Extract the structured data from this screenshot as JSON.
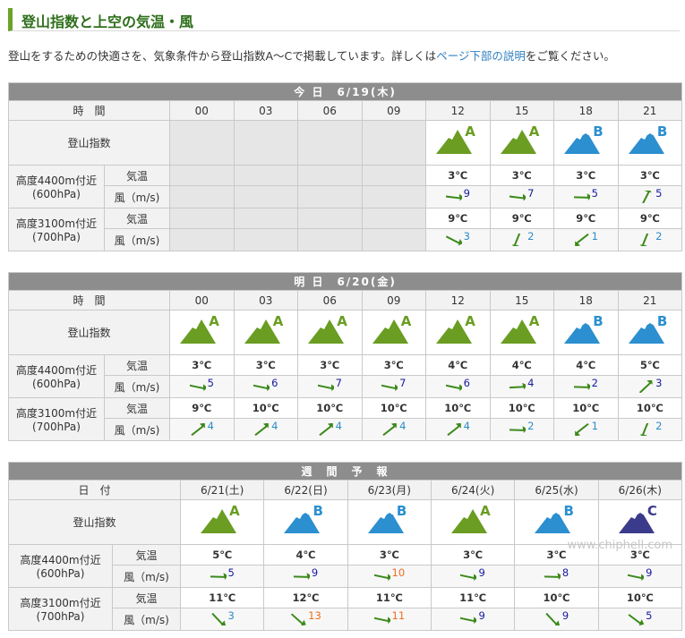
{
  "page_title": "登山指数と上空の気温・風",
  "intro": {
    "before": "登山をするための快適さを、気象条件から登山指数A～Cで掲載しています。詳しくは",
    "link": "ページ下部の説明",
    "after": "をご覧ください。"
  },
  "labels": {
    "time": "時　間",
    "date": "日　付",
    "index": "登山指数",
    "alt_high": "高度4400m付近",
    "alt_high_hpa": "(600hPa)",
    "alt_low": "高度3100m付近",
    "alt_low_hpa": "(700hPa)",
    "temp": "気温",
    "wind": "風（m/s)"
  },
  "colors": {
    "greenMountain": "#6a9d22",
    "blueMountain": "#2b8fd0",
    "navyMountain": "#3b3b8c"
  },
  "today": {
    "header": "今 日　6/19(木)",
    "times": [
      "00",
      "03",
      "06",
      "09",
      "12",
      "15",
      "18",
      "21"
    ],
    "index": [
      "",
      "",
      "",
      "",
      "A",
      "A",
      "B",
      "B"
    ],
    "high_temp": [
      "",
      "",
      "",
      "",
      "3℃",
      "3℃",
      "3℃",
      "3℃"
    ],
    "high_wind": [
      null,
      null,
      null,
      null,
      {
        "v": "9",
        "d": 35
      },
      {
        "v": "7",
        "d": 35
      },
      {
        "v": "5",
        "d": 30
      },
      {
        "v": "5",
        "d": -35
      }
    ],
    "low_temp": [
      "",
      "",
      "",
      "",
      "9℃",
      "9℃",
      "9℃",
      "9℃"
    ],
    "low_wind": [
      null,
      null,
      null,
      null,
      {
        "v": "3",
        "d": 55
      },
      {
        "v": "2",
        "d": 140
      },
      {
        "v": "1",
        "d": 170
      },
      {
        "v": "2",
        "d": 140
      }
    ]
  },
  "tomorrow": {
    "header": "明 日　6/20(金)",
    "times": [
      "00",
      "03",
      "06",
      "09",
      "12",
      "15",
      "18",
      "21"
    ],
    "index": [
      "A",
      "A",
      "A",
      "A",
      "A",
      "A",
      "B",
      "B"
    ],
    "high_temp": [
      "3℃",
      "3℃",
      "3℃",
      "3℃",
      "4℃",
      "4℃",
      "4℃",
      "5℃"
    ],
    "high_wind": [
      {
        "v": "5",
        "d": 40
      },
      {
        "v": "6",
        "d": 40
      },
      {
        "v": "7",
        "d": 40
      },
      {
        "v": "7",
        "d": 40
      },
      {
        "v": "6",
        "d": 40
      },
      {
        "v": "4",
        "d": 25
      },
      {
        "v": "2",
        "d": 30
      },
      {
        "v": "3",
        "d": -15
      }
    ],
    "low_temp": [
      "9℃",
      "10℃",
      "10℃",
      "10℃",
      "10℃",
      "10℃",
      "10℃",
      "10℃"
    ],
    "low_wind": [
      {
        "v": "4",
        "d": -10
      },
      {
        "v": "4",
        "d": -10
      },
      {
        "v": "4",
        "d": -10
      },
      {
        "v": "4",
        "d": -10
      },
      {
        "v": "4",
        "d": -10
      },
      {
        "v": "2",
        "d": 30
      },
      {
        "v": "1",
        "d": 170
      },
      {
        "v": "2",
        "d": 140
      }
    ]
  },
  "weekly": {
    "header": "週　間　予　報",
    "dates": [
      "6/21(土)",
      "6/22(日)",
      "6/23(月)",
      "6/24(火)",
      "6/25(水)",
      "6/26(木)"
    ],
    "index": [
      "A",
      "B",
      "B",
      "A",
      "B",
      "C"
    ],
    "high_temp": [
      "5℃",
      "4℃",
      "3℃",
      "3℃",
      "3℃",
      "3℃"
    ],
    "high_wind": [
      {
        "v": "5",
        "d": 30,
        "c": "blue"
      },
      {
        "v": "9",
        "d": 30,
        "c": "blue"
      },
      {
        "v": "10",
        "d": 40,
        "c": "orange"
      },
      {
        "v": "9",
        "d": 40,
        "c": "blue"
      },
      {
        "v": "8",
        "d": 30,
        "c": "blue"
      },
      {
        "v": "9",
        "d": 40,
        "c": "blue"
      }
    ],
    "low_temp": [
      "11℃",
      "12℃",
      "11℃",
      "11℃",
      "10℃",
      "10℃"
    ],
    "low_wind": [
      {
        "v": "3",
        "d": 75,
        "c": "teal"
      },
      {
        "v": "13",
        "d": 70,
        "c": "orange"
      },
      {
        "v": "11",
        "d": 40,
        "c": "orange"
      },
      {
        "v": "9",
        "d": 40,
        "c": "blue"
      },
      {
        "v": "9",
        "d": 75,
        "c": "blue"
      },
      {
        "v": "5",
        "d": 65,
        "c": "blue"
      }
    ]
  },
  "watermark": "www.chiphell.com"
}
